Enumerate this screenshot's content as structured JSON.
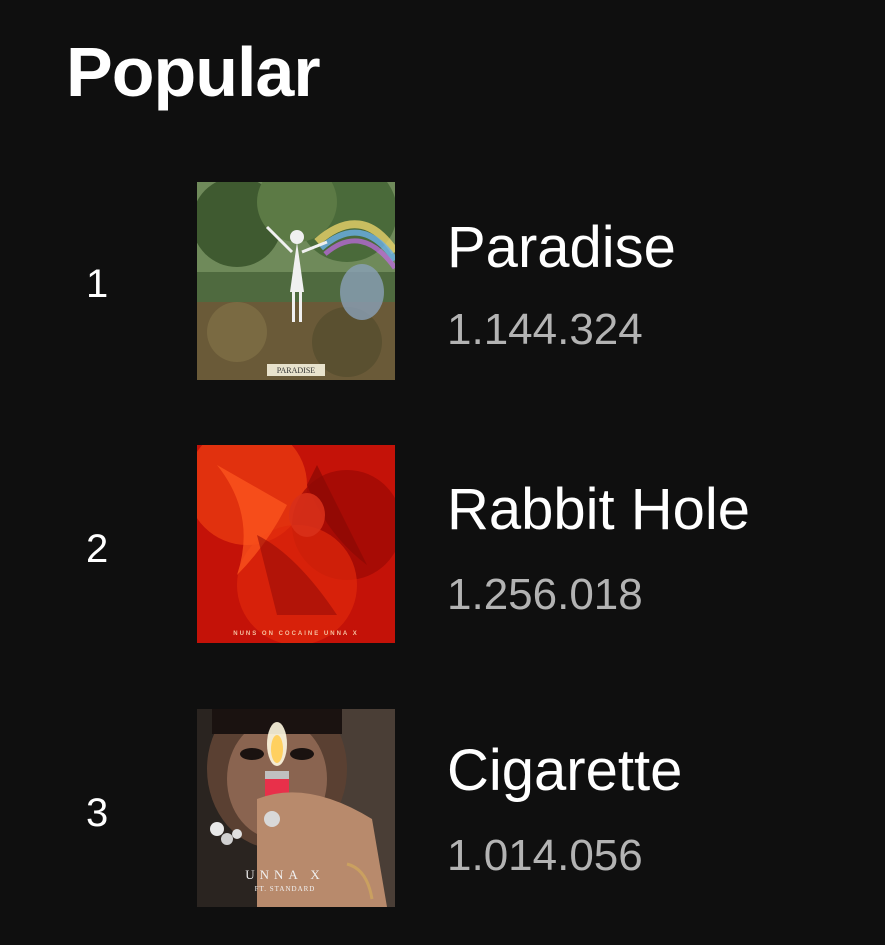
{
  "section": {
    "title": "Popular"
  },
  "tracks": [
    {
      "index": "1",
      "title": "Paradise",
      "plays": "1.144.324",
      "cover_text": "PARADISE"
    },
    {
      "index": "2",
      "title": "Rabbit Hole",
      "plays": "1.256.018",
      "cover_text": "NUNS ON COCAINE UNNA X"
    },
    {
      "index": "3",
      "title": "Cigarette",
      "plays": "1.014.056",
      "cover_text": "UNNA X",
      "cover_subtext": "FT. STANDARD"
    }
  ],
  "colors": {
    "background": "#0f0f0f",
    "primary_text": "#ffffff",
    "secondary_text": "#b3b3b3"
  }
}
